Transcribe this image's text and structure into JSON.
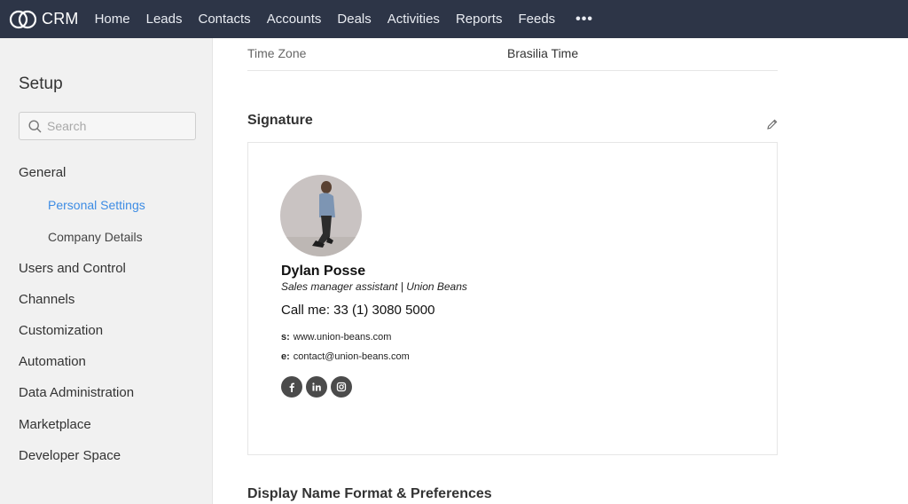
{
  "brand": {
    "name": "CRM",
    "icon": "crm-logo-icon"
  },
  "nav": {
    "items": [
      "Home",
      "Leads",
      "Contacts",
      "Accounts",
      "Deals",
      "Activities",
      "Reports",
      "Feeds"
    ],
    "more": "•••"
  },
  "sidebar": {
    "title": "Setup",
    "search_placeholder": "Search",
    "sections": {
      "general": "General",
      "personal_settings": "Personal Settings",
      "company_details": "Company Details",
      "users_and_control": "Users and Control",
      "channels": "Channels",
      "customization": "Customization",
      "automation": "Automation",
      "data_administration": "Data Administration",
      "marketplace": "Marketplace",
      "developer_space": "Developer Space"
    }
  },
  "main": {
    "time_zone": {
      "label": "Time Zone",
      "value": "Brasilia Time"
    },
    "signature_title": "Signature",
    "signature": {
      "name": "Dylan Posse",
      "role": "Sales manager assistant | Union Beans",
      "call": "Call me: 33 (1) 3080 5000",
      "site_label": "s:",
      "site": "www.union-beans.com",
      "email_label": "e:",
      "email": "contact@union-beans.com",
      "socials": [
        "facebook-icon",
        "linkedin-icon",
        "instagram-icon"
      ]
    },
    "display_name_title": "Display Name Format & Preferences"
  },
  "colors": {
    "topbar": "#2d3547",
    "sidebar": "#f1f1f1",
    "active_link": "#3d8ce4"
  }
}
